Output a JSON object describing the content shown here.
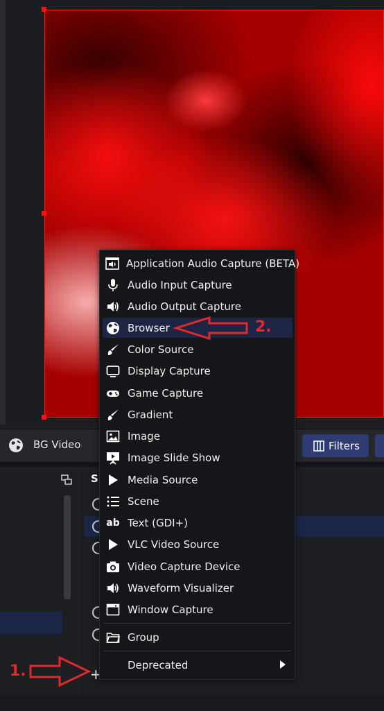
{
  "colors": {
    "accent": "#2f3c74",
    "selection": "#1b2547",
    "menu_highlight": "#1e2544",
    "preview_red": "#ff1010",
    "annotation_red": "#e02a2a"
  },
  "source_toolbar": {
    "selected_source": "BG Video",
    "selected_source_icon": "globe-icon",
    "filters_label": "Filters",
    "filters_icon": "filters-icon"
  },
  "sources_dock": {
    "title": "S",
    "add_button_label": "+"
  },
  "add_source_menu": {
    "items": [
      {
        "label": "Application Audio Capture (BETA)",
        "icon": "app-audio-icon"
      },
      {
        "label": "Audio Input Capture",
        "icon": "microphone-icon"
      },
      {
        "label": "Audio Output Capture",
        "icon": "speaker-icon"
      },
      {
        "label": "Browser",
        "icon": "globe-icon"
      },
      {
        "label": "Color Source",
        "icon": "brush-icon"
      },
      {
        "label": "Display Capture",
        "icon": "monitor-icon"
      },
      {
        "label": "Game Capture",
        "icon": "gamepad-icon"
      },
      {
        "label": "Gradient",
        "icon": "brush-icon"
      },
      {
        "label": "Image",
        "icon": "image-icon"
      },
      {
        "label": "Image Slide Show",
        "icon": "slideshow-icon"
      },
      {
        "label": "Media Source",
        "icon": "play-icon"
      },
      {
        "label": "Scene",
        "icon": "list-icon"
      },
      {
        "label": "Text (GDI+)",
        "icon": "text-icon"
      },
      {
        "label": "VLC Video Source",
        "icon": "play-icon"
      },
      {
        "label": "Video Capture Device",
        "icon": "camera-icon"
      },
      {
        "label": "Waveform Visualizer",
        "icon": "speaker-icon"
      },
      {
        "label": "Window Capture",
        "icon": "window-icon"
      }
    ],
    "group_label": "Group",
    "group_icon": "folder-icon",
    "deprecated_label": "Deprecated",
    "highlighted_item": "Browser"
  },
  "annotations": {
    "step1": "1.",
    "step2": "2."
  }
}
